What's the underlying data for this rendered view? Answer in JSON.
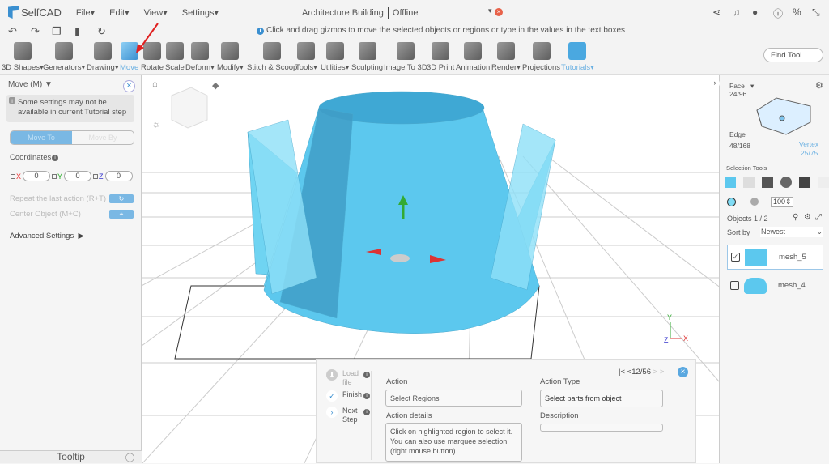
{
  "app": {
    "name": "SelfCAD",
    "menus": [
      "File▾",
      "Edit▾",
      "View▾",
      "Settings▾"
    ],
    "document_title": "Architecture Building",
    "status": "Offline"
  },
  "hint": "Click and drag gizmos to move the selected objects or regions or type in the values in the text boxes",
  "toolbar": [
    "3D Shapes▾",
    "Generators▾",
    "Drawing▾",
    "Move",
    "Rotate",
    "Scale",
    "Deform▾",
    "Modify▾",
    "Stitch & Scoop",
    "Tools▾",
    "Utilities▾",
    "Sculpting",
    "Image To 3D",
    "3D Print",
    "Animation",
    "Render▾",
    "Projections",
    "Tutorials▾"
  ],
  "find_tool": "Find Tool",
  "left_panel": {
    "title": "Move (M) ▼",
    "note": "Some settings may not be available in current Tutorial step",
    "move_to": "Move To",
    "move_by": "Move By",
    "coordinates": "Coordinates",
    "x_label": "X",
    "y_label": "Y",
    "z_label": "Z",
    "x": "0",
    "y": "0",
    "z": "0",
    "repeat": "Repeat the last action (R+T)",
    "center": "Center Object (M+C)",
    "advanced": "Advanced Settings",
    "tooltip": "Tooltip"
  },
  "right_panel": {
    "face_label": "Face",
    "face_count": "24/96",
    "edge_label": "Edge",
    "edge_count": "48/168",
    "vertex_label": "Vertex",
    "vertex_count": "25/75",
    "selection_tools": "Selection Tools",
    "size": "100",
    "objects": "Objects 1 / 2",
    "sort_by": "Sort by",
    "sort_value": "Newest",
    "items": [
      {
        "name": "mesh_5",
        "checked": true
      },
      {
        "name": "mesh_4",
        "checked": false
      }
    ]
  },
  "tutorial": {
    "steps": [
      "Load file",
      "Finish",
      "Next Step"
    ],
    "pager": "12/56",
    "action_label": "Action",
    "action": "Select Regions",
    "details_label": "Action details",
    "details": "Click on highlighted region to select it. You can also use marquee selection (right mouse button).",
    "type_label": "Action Type",
    "type": "Select parts from object",
    "description_label": "Description",
    "description": ""
  },
  "axes": {
    "x": "X",
    "y": "Y",
    "z": "Z"
  },
  "colors": {
    "accent": "#3a8fd0",
    "mesh": "#5cc8ee"
  }
}
